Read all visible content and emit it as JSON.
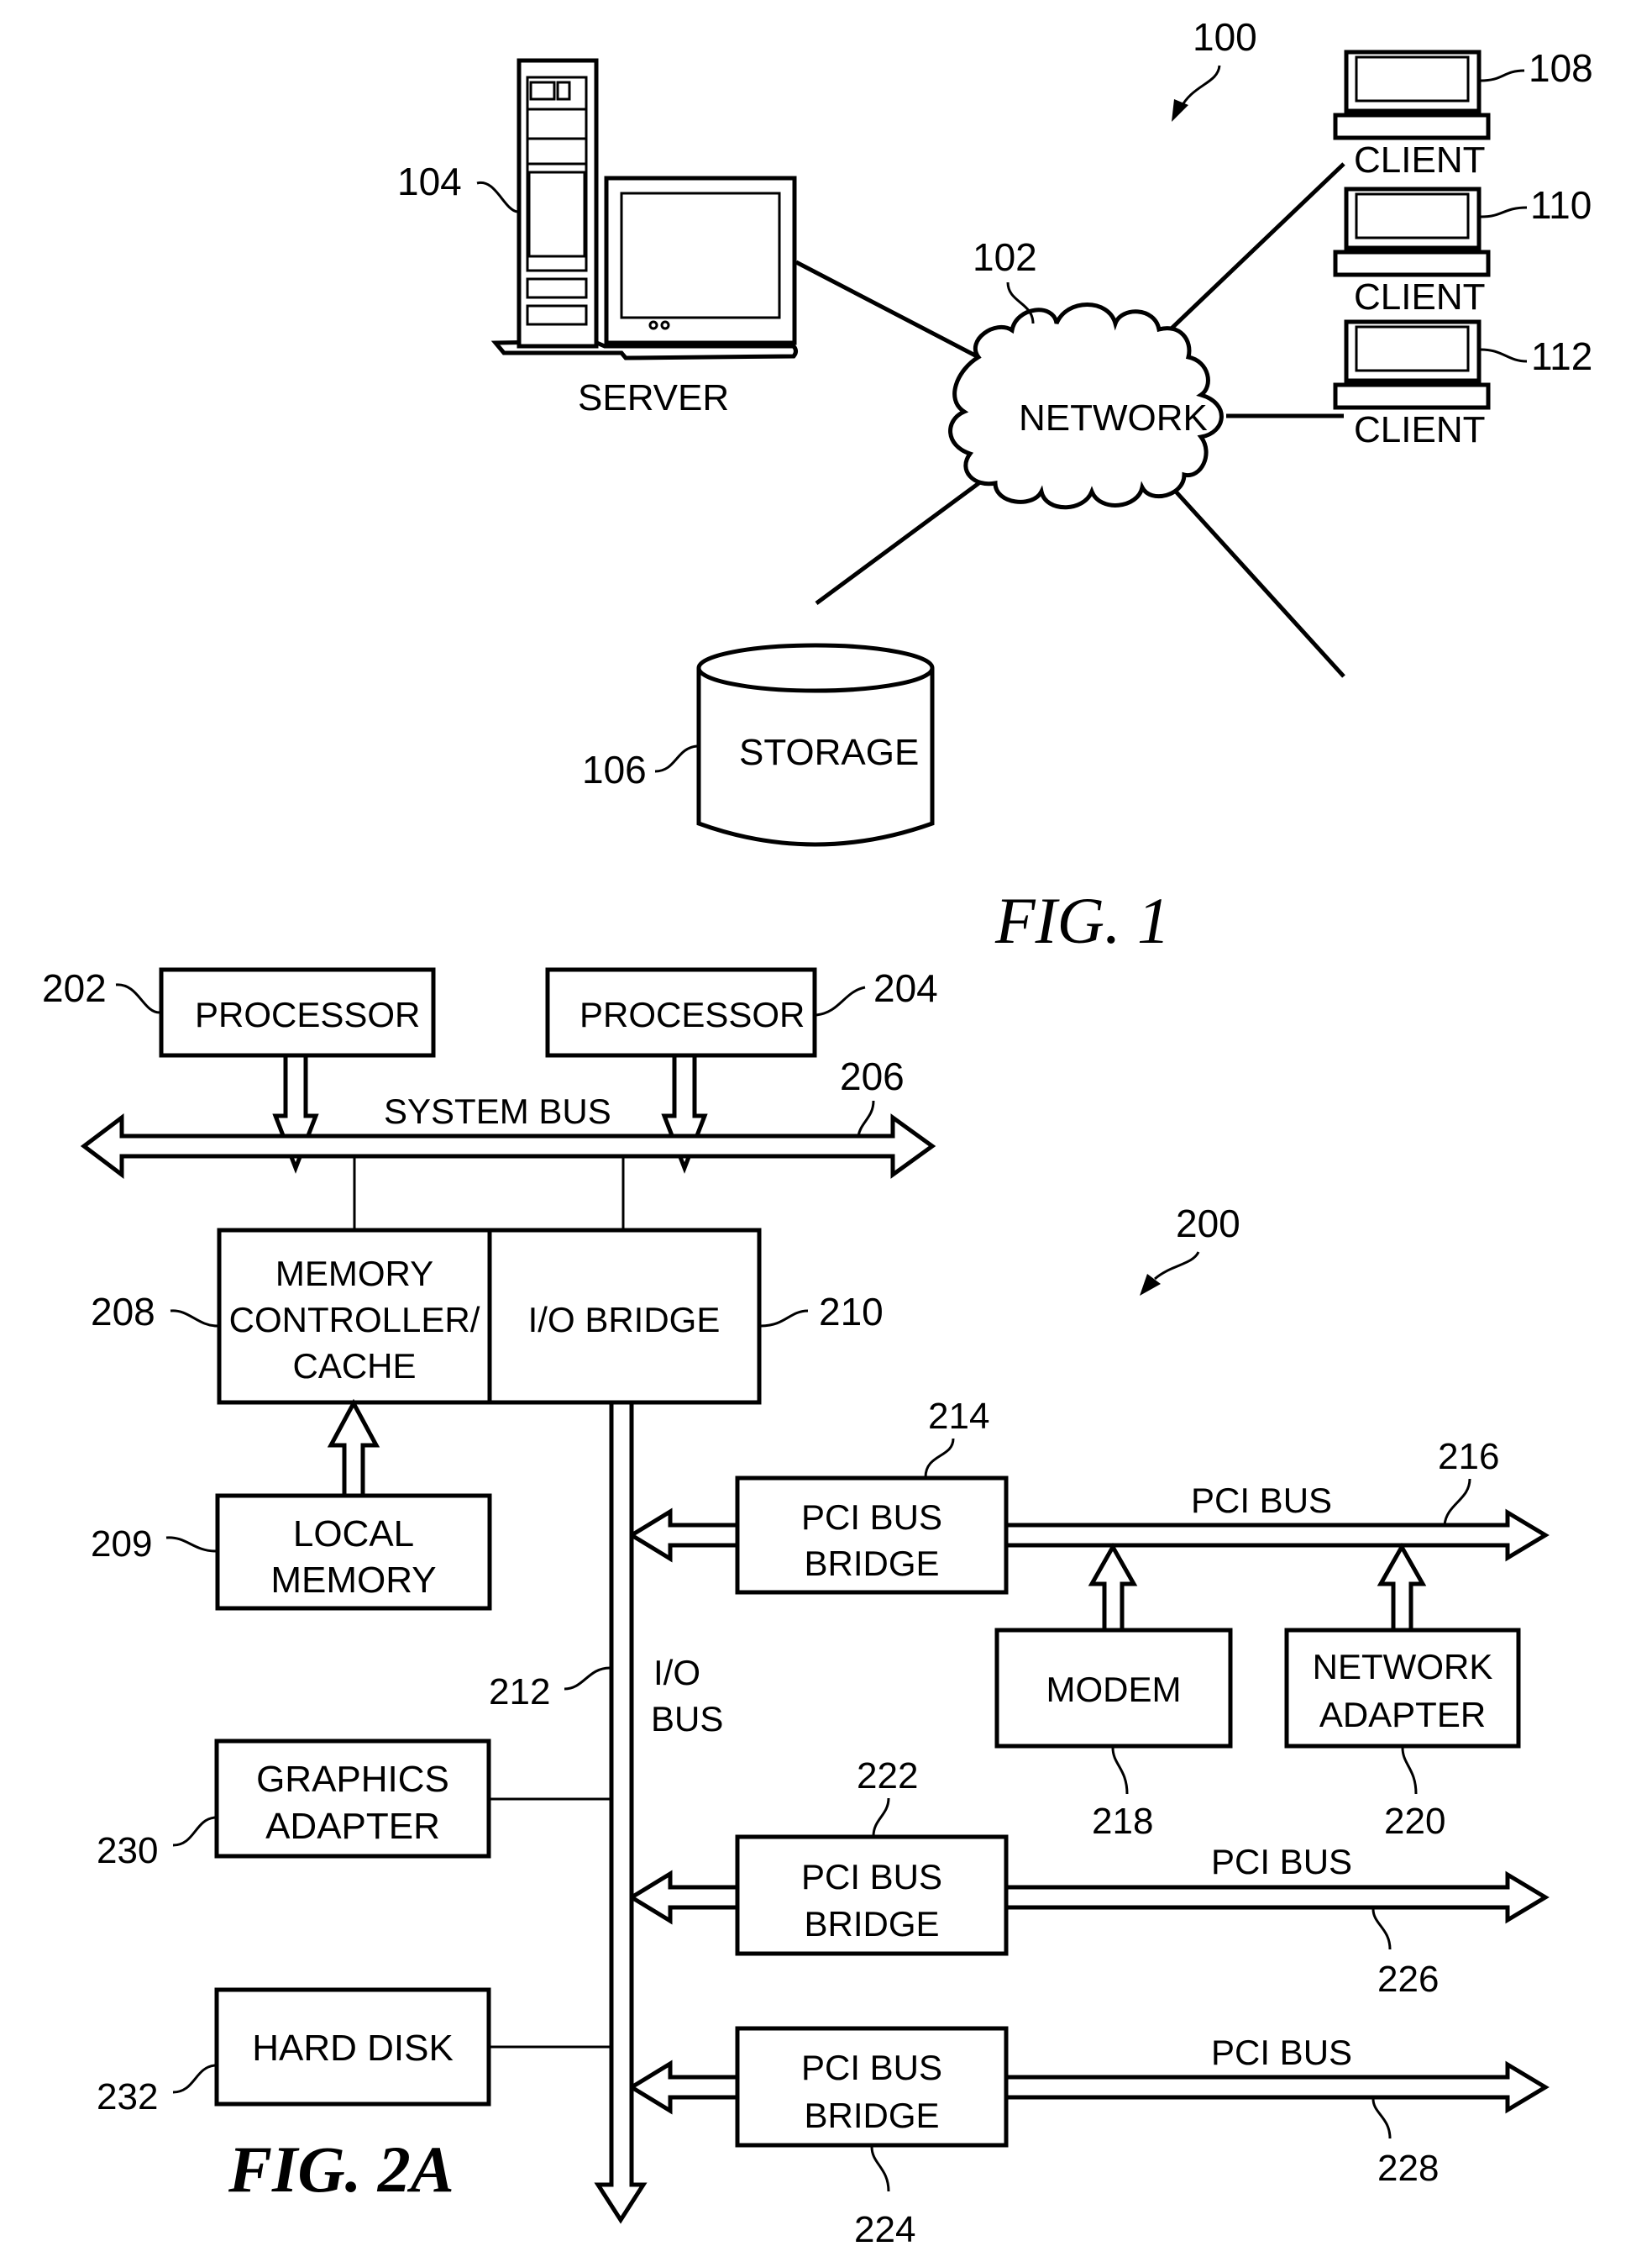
{
  "fig1": {
    "caption": "FIG. 1",
    "system_ref": "100",
    "network": {
      "ref": "102",
      "label": "NETWORK"
    },
    "server": {
      "ref": "104",
      "label": "SERVER"
    },
    "storage": {
      "ref": "106",
      "label": "STORAGE"
    },
    "clients": [
      {
        "ref": "108",
        "label": "CLIENT"
      },
      {
        "ref": "110",
        "label": "CLIENT"
      },
      {
        "ref": "112",
        "label": "CLIENT"
      }
    ]
  },
  "fig2a": {
    "caption": "FIG. 2A",
    "system_ref": "200",
    "processors": [
      {
        "ref": "202",
        "label": "PROCESSOR"
      },
      {
        "ref": "204",
        "label": "PROCESSOR"
      }
    ],
    "system_bus": {
      "ref": "206",
      "label": "SYSTEM BUS"
    },
    "memory_controller": {
      "ref": "208",
      "lines": [
        "MEMORY",
        "CONTROLLER/",
        "CACHE"
      ]
    },
    "local_memory": {
      "ref": "209",
      "lines": [
        "LOCAL",
        "MEMORY"
      ]
    },
    "io_bridge": {
      "ref": "210",
      "label": "I/O BRIDGE"
    },
    "io_bus": {
      "ref": "212",
      "lines": [
        "I/O",
        "BUS"
      ]
    },
    "pci_bridges": [
      {
        "ref": "214",
        "lines": [
          "PCI BUS",
          "BRIDGE"
        ],
        "bus_ref": "216",
        "bus_label": "PCI BUS"
      },
      {
        "ref": "222",
        "lines": [
          "PCI BUS",
          "BRIDGE"
        ],
        "bus_ref": "226",
        "bus_label": "PCI BUS"
      },
      {
        "ref": "224",
        "lines": [
          "PCI BUS",
          "BRIDGE"
        ],
        "bus_ref": "228",
        "bus_label": "PCI BUS"
      }
    ],
    "modem": {
      "ref": "218",
      "label": "MODEM"
    },
    "network_adapter": {
      "ref": "220",
      "lines": [
        "NETWORK",
        "ADAPTER"
      ]
    },
    "graphics_adapter": {
      "ref": "230",
      "lines": [
        "GRAPHICS",
        "ADAPTER"
      ]
    },
    "hard_disk": {
      "ref": "232",
      "label": "HARD DISK"
    }
  }
}
